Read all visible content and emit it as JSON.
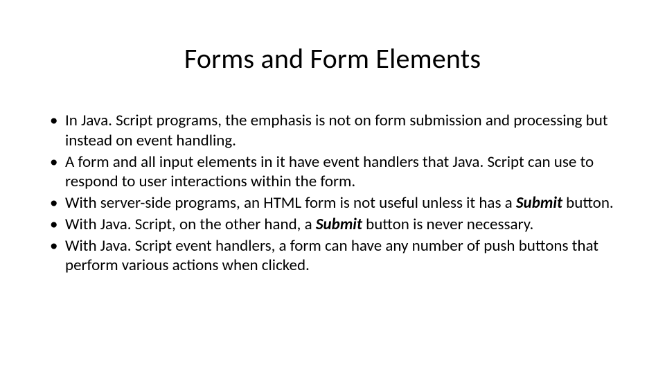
{
  "slide": {
    "title": "Forms and Form Elements",
    "bullets": [
      {
        "pre": "In Java. Script programs, the emphasis is not on form submission and processing but instead on event handling.",
        "bold": "",
        "post": ""
      },
      {
        "pre": "A form and all input elements in it have event handlers that Java. Script can use to respond to user interactions within the form.",
        "bold": "",
        "post": ""
      },
      {
        "pre": "With server-side programs, an HTML form is not useful unless it has a ",
        "bold": "Submit",
        "post": " button."
      },
      {
        "pre": "With Java. Script, on the other hand, a ",
        "bold": "Submit",
        "post": " button is never necessary."
      },
      {
        "pre": "With Java. Script event handlers, a form can have any number of push buttons that perform various actions when clicked.",
        "bold": "",
        "post": ""
      }
    ]
  }
}
